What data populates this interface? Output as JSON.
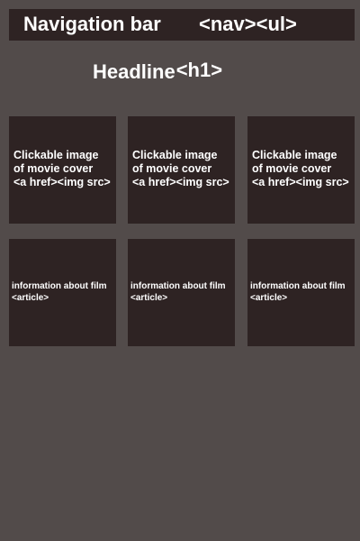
{
  "nav": {
    "title": "Navigation bar",
    "tag": "<nav><ul>"
  },
  "headline": {
    "text": "Headline",
    "tag": "<h1>"
  },
  "covers": [
    {
      "line1": "Clickable image",
      "line2": "of movie cover",
      "line3": "<a href><img src>"
    },
    {
      "line1": "Clickable image",
      "line2": "of movie cover",
      "line3": "<a href><img src>"
    },
    {
      "line1": "Clickable image",
      "line2": "of movie cover",
      "line3": "<a href><img src>"
    }
  ],
  "articles": [
    {
      "line1": "information about film",
      "line2": "<article>"
    },
    {
      "line1": "information about film",
      "line2": "<article>"
    },
    {
      "line1": "information about film",
      "line2": "<article>"
    }
  ]
}
